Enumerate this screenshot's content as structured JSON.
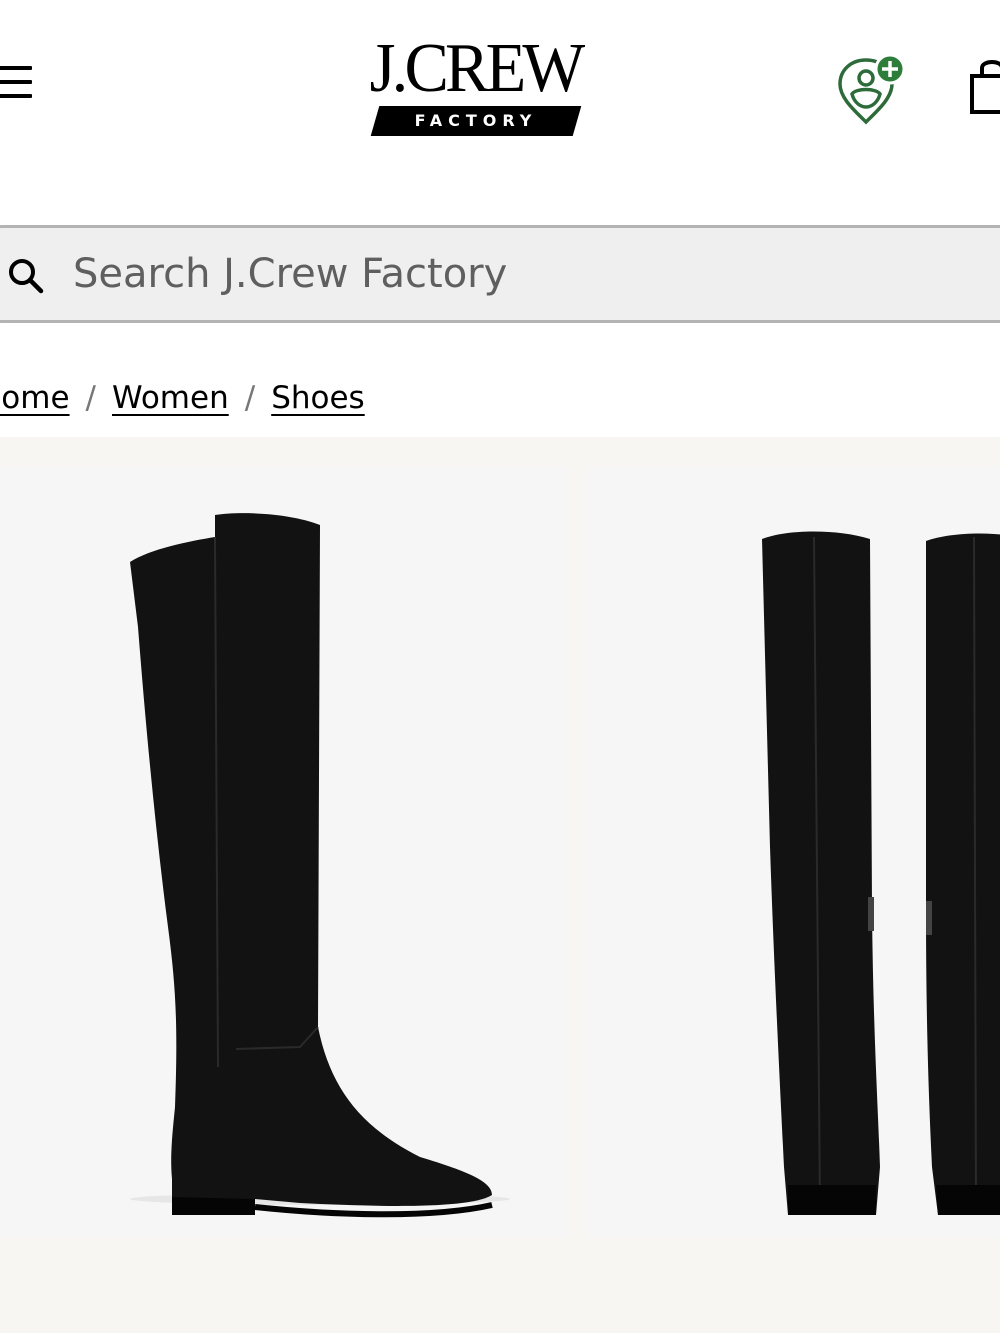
{
  "brand": {
    "name": "J.CREW",
    "sub": "FACTORY"
  },
  "header": {
    "menu_icon": "hamburger-menu-icon",
    "location_icon": "store-locator-icon",
    "bag_icon": "shopping-bag-icon",
    "accent_color": "#2e7d3a"
  },
  "search": {
    "placeholder": "Search J.Crew Factory",
    "icon": "search-icon"
  },
  "breadcrumb": {
    "items": [
      "Home",
      "Women",
      "Shoes"
    ],
    "separator": "/"
  },
  "gallery": {
    "images": [
      {
        "alt": "over-the-knee boot side view"
      },
      {
        "alt": "over-the-knee boots back view"
      }
    ]
  }
}
